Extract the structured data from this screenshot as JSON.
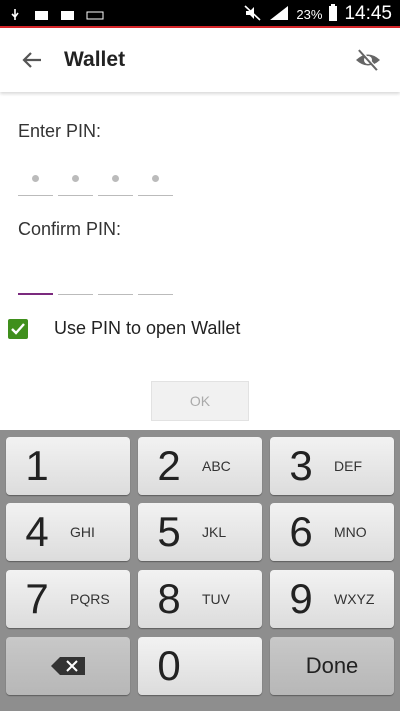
{
  "status_bar": {
    "battery": "23%",
    "time": "14:45"
  },
  "app_bar": {
    "title": "Wallet"
  },
  "pin": {
    "enter_label": "Enter PIN:",
    "confirm_label": "Confirm PIN:",
    "entered_digits": 4,
    "confirm_digits": 0
  },
  "option": {
    "label": "Use PIN to open Wallet",
    "checked": true
  },
  "ok_label": "OK",
  "keypad": {
    "keys": [
      {
        "num": "1",
        "letters": ""
      },
      {
        "num": "2",
        "letters": "ABC"
      },
      {
        "num": "3",
        "letters": "DEF"
      },
      {
        "num": "4",
        "letters": "GHI"
      },
      {
        "num": "5",
        "letters": "JKL"
      },
      {
        "num": "6",
        "letters": "MNO"
      },
      {
        "num": "7",
        "letters": "PQRS"
      },
      {
        "num": "8",
        "letters": "TUV"
      },
      {
        "num": "9",
        "letters": "WXYZ"
      }
    ],
    "zero": "0",
    "done_label": "Done"
  },
  "colors": {
    "accent": "#7b2a7e",
    "checkbox": "#3f8f1c",
    "status_line": "#d7262a"
  }
}
